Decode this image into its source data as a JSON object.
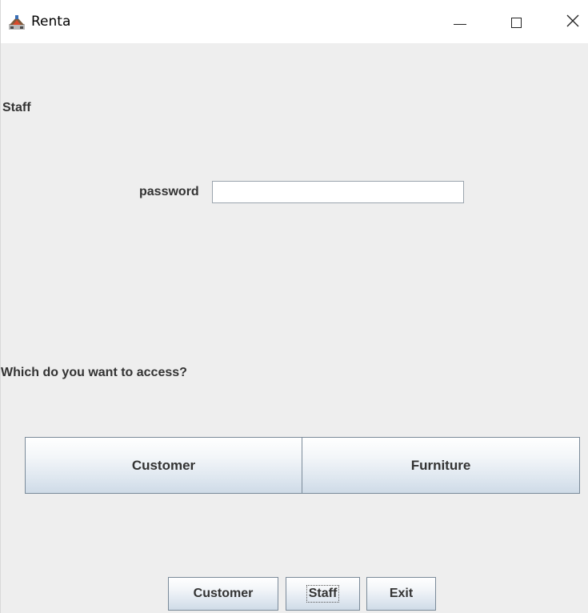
{
  "window": {
    "title": "Renta",
    "icon": "java-app-icon"
  },
  "titlebar": {
    "minimize_icon": "minimize-icon",
    "maximize_icon": "maximize-icon",
    "close_icon": "close-icon",
    "close_glyph": "✕"
  },
  "content": {
    "section_heading": "Staff",
    "password_label": "password",
    "password_value": "",
    "access_question": "Which do you want to access?",
    "access_buttons": {
      "customer": "Customer",
      "furniture": "Furniture"
    }
  },
  "bottom_nav": {
    "customer": "Customer",
    "staff": "Staff",
    "exit": "Exit",
    "focused": "staff"
  }
}
